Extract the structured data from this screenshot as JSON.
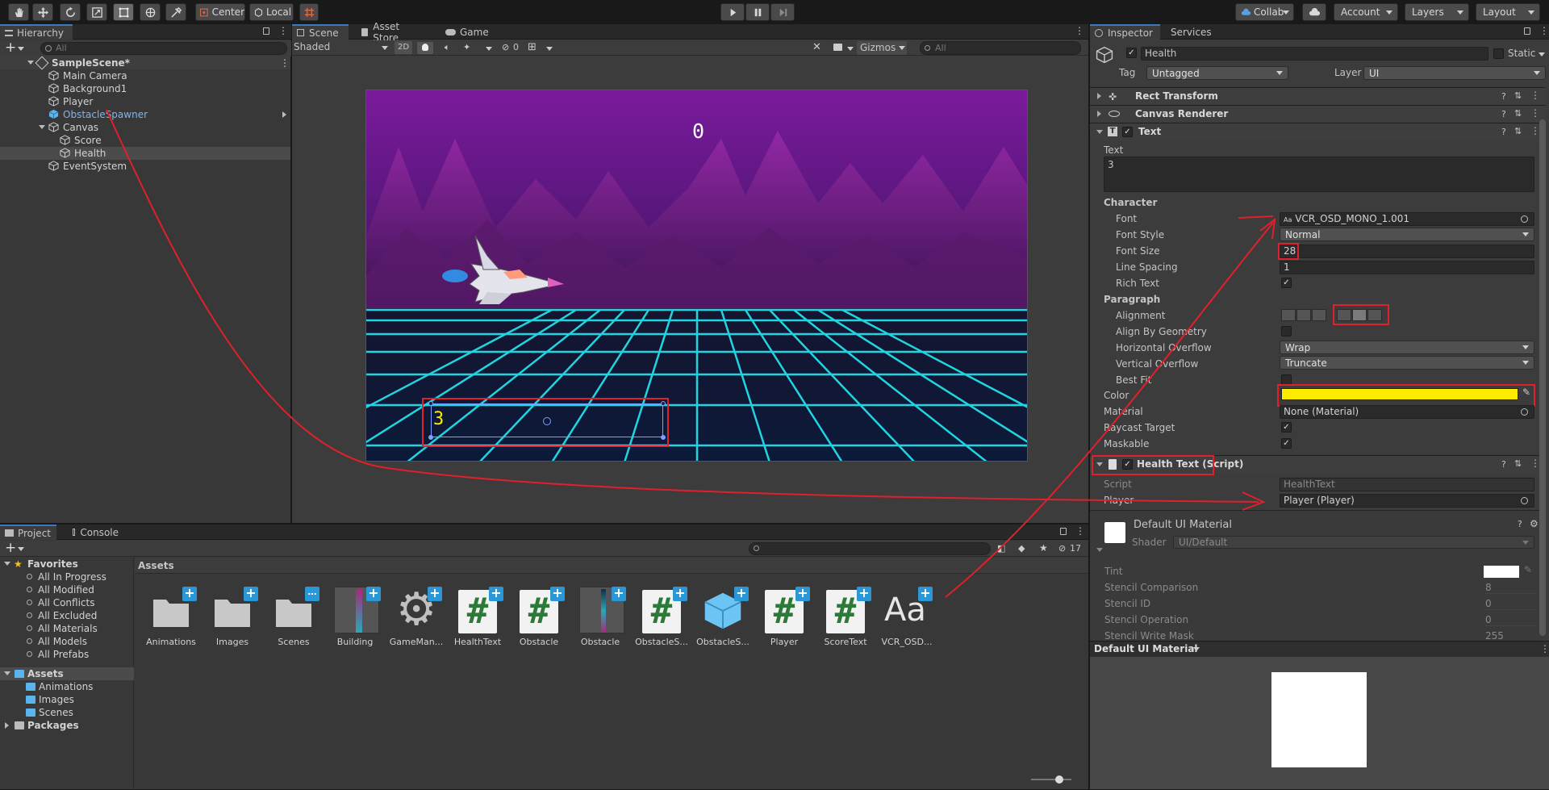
{
  "toolbar": {
    "pivot": "Center",
    "space": "Local",
    "collab": "Collab",
    "account": "Account",
    "layers": "Layers",
    "layout": "Layout"
  },
  "hierarchy": {
    "tab": "Hierarchy",
    "search_placeholder": "All",
    "scene": "SampleScene*",
    "items": [
      {
        "label": "Main Camera"
      },
      {
        "label": "Background1"
      },
      {
        "label": "Player"
      },
      {
        "label": "ObstacleSpawner"
      },
      {
        "label": "Canvas"
      },
      {
        "label": "Score"
      },
      {
        "label": "Health"
      },
      {
        "label": "EventSystem"
      }
    ]
  },
  "scene_view": {
    "tabs": [
      "Scene",
      "Asset Store",
      "Game"
    ],
    "shading": "Shaded",
    "mode_2d": "2D",
    "hidden_count": "0",
    "gizmos": "Gizmos",
    "search_placeholder": "All",
    "score_text": "0",
    "health_text": "3"
  },
  "inspector": {
    "tabs": [
      "Inspector",
      "Services"
    ],
    "object_name": "Health",
    "static_label": "Static",
    "tag_label": "Tag",
    "tag_value": "Untagged",
    "layer_label": "Layer",
    "layer_value": "UI",
    "components": {
      "rect_transform": "Rect Transform",
      "canvas_renderer": "Canvas Renderer",
      "text": "Text",
      "health_script": "Health Text (Script)"
    },
    "text_label": "Text",
    "text_value": "3",
    "character_header": "Character",
    "font_label": "Font",
    "font_value": "VCR_OSD_MONO_1.001",
    "font_style_label": "Font Style",
    "font_style_value": "Normal",
    "font_size_label": "Font Size",
    "font_size_value": "28",
    "line_spacing_label": "Line Spacing",
    "line_spacing_value": "1",
    "rich_text_label": "Rich Text",
    "paragraph_header": "Paragraph",
    "alignment_label": "Alignment",
    "align_geometry_label": "Align By Geometry",
    "h_overflow_label": "Horizontal Overflow",
    "h_overflow_value": "Wrap",
    "v_overflow_label": "Vertical Overflow",
    "v_overflow_value": "Truncate",
    "best_fit_label": "Best Fit",
    "color_label": "Color",
    "color_value": "#ffeb00",
    "material_label": "Material",
    "material_value": "None (Material)",
    "raycast_label": "Raycast Target",
    "maskable_label": "Maskable",
    "script_label": "Script",
    "script_value": "HealthText",
    "player_label": "Player",
    "player_value": "Player (Player)",
    "material_name": "Default UI Material",
    "shader_label": "Shader",
    "shader_value": "UI/Default",
    "tint_label": "Tint",
    "stencil_comparison_label": "Stencil Comparison",
    "stencil_comparison_value": "8",
    "stencil_id_label": "Stencil ID",
    "stencil_id_value": "0",
    "stencil_op_label": "Stencil Operation",
    "stencil_op_value": "0",
    "stencil_write_label": "Stencil Write Mask",
    "stencil_write_value": "255",
    "preview_title": "Default UI Material"
  },
  "project": {
    "tabs": [
      "Project",
      "Console"
    ],
    "hidden_count": "17",
    "favorites_label": "Favorites",
    "favorites": [
      "All In Progress",
      "All Modified",
      "All Conflicts",
      "All Excluded",
      "All Materials",
      "All Models",
      "All Prefabs"
    ],
    "assets_label": "Assets",
    "asset_folders": [
      "Animations",
      "Images",
      "Scenes"
    ],
    "packages_label": "Packages",
    "breadcrumb": "Assets",
    "assets": [
      {
        "label": "Animations",
        "icon": "folder-icon"
      },
      {
        "label": "Images",
        "icon": "folder-icon"
      },
      {
        "label": "Scenes",
        "icon": "folder-icon"
      },
      {
        "label": "Building",
        "icon": "sprite-icon"
      },
      {
        "label": "GameMan...",
        "icon": "gear-icon"
      },
      {
        "label": "HealthText",
        "icon": "script-icon"
      },
      {
        "label": "Obstacle",
        "icon": "script-icon"
      },
      {
        "label": "Obstacle",
        "icon": "sprite-icon"
      },
      {
        "label": "ObstacleS...",
        "icon": "script-icon"
      },
      {
        "label": "ObstacleS...",
        "icon": "prefab-icon"
      },
      {
        "label": "Player",
        "icon": "script-icon"
      },
      {
        "label": "ScoreText",
        "icon": "script-icon"
      },
      {
        "label": "VCR_OSD...",
        "icon": "font-icon"
      }
    ]
  }
}
